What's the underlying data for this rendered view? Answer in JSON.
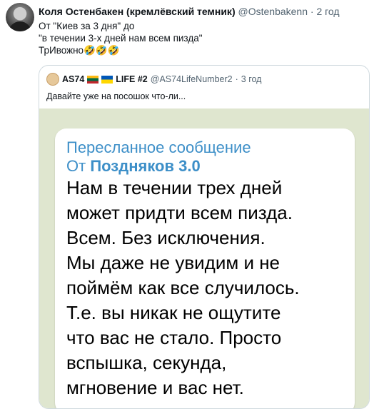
{
  "tweet": {
    "author_name": "Коля Остенбакен (кремлёвский темник)",
    "author_handle": "@Ostenbakenn",
    "separator": "·",
    "time": "2 год",
    "text_lines": [
      "От \"Киев за 3 дня\" до",
      "\"в течении 3-х дней нам всем пизда\"",
      "ТрИвожно🤣🤣🤣"
    ]
  },
  "quote": {
    "author_name": "AS74",
    "author_name_suffix": "LIFE #2",
    "author_handle": "@AS74LifeNumber2",
    "separator": "·",
    "time": "3 год",
    "text": "Давайте уже на посошок что-ли...",
    "flags": [
      "lithuania-flag",
      "ukraine-flag"
    ]
  },
  "message": {
    "forwarded_label": "Пересланное сообщение",
    "from_label": "От",
    "from_name": "Поздняков 3.0",
    "lines": [
      "Нам в течении трех дней",
      "может придти всем пизда.",
      "Всем. Без исключения.",
      "Мы даже не увидим и не",
      "поймём как все случилось.",
      "Т.е. вы никак не ощутите",
      "что вас не стало. Просто",
      "вспышка, секунда,",
      "мгновение и вас нет."
    ]
  },
  "colors": {
    "text": "#0f1419",
    "secondary": "#536471",
    "border": "#cfd9de",
    "telegram_link": "#3d8fc8",
    "chat_background": "#dfe6cf"
  }
}
